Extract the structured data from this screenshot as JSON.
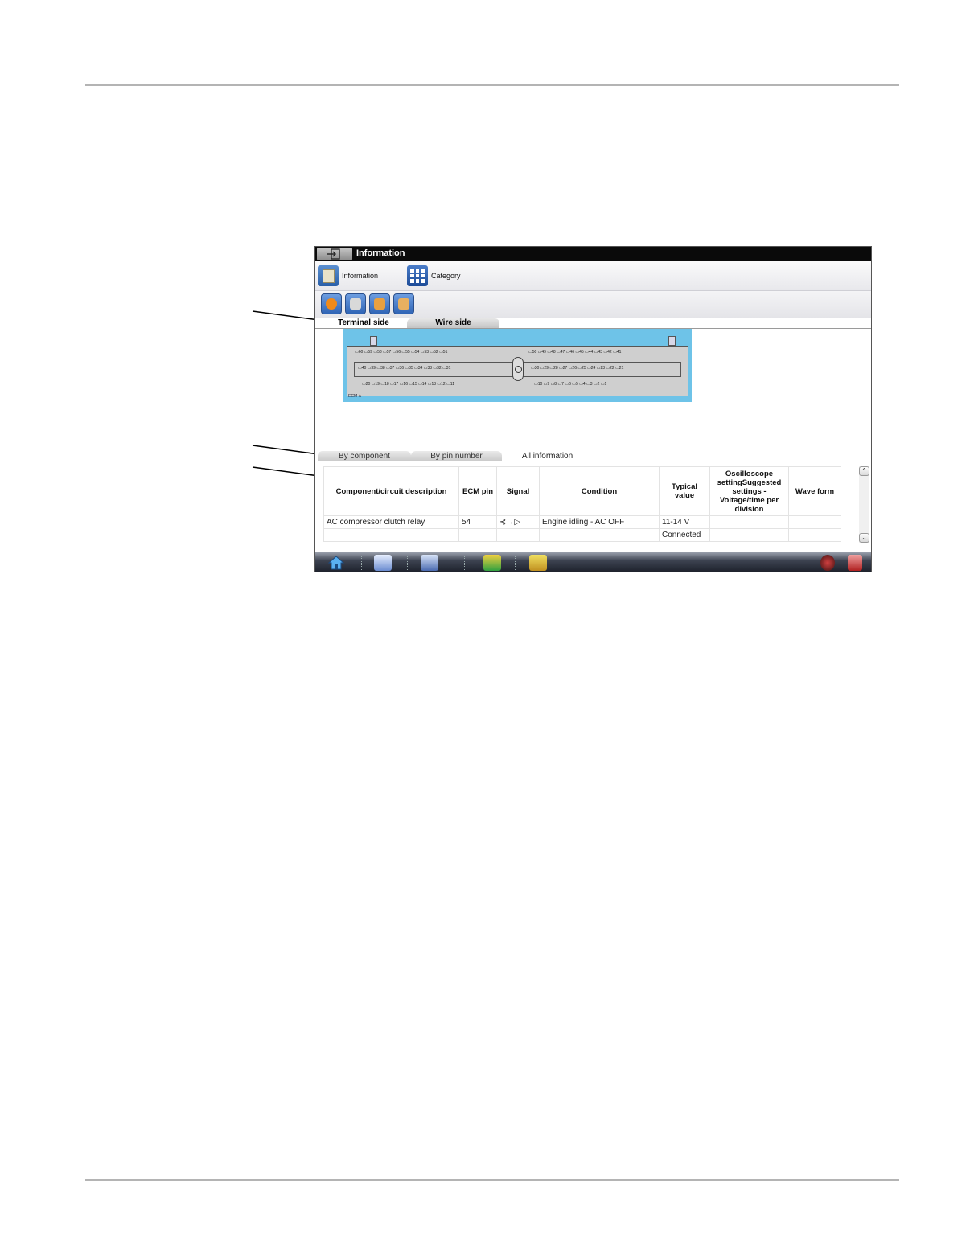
{
  "window": {
    "title": "Information"
  },
  "navbar": {
    "items": [
      {
        "label": "Information",
        "icon": "information-book-icon"
      },
      {
        "label": "Category",
        "icon": "category-grid-icon"
      }
    ]
  },
  "toolbar": {
    "buttons": [
      {
        "icon": "help-icon",
        "color": "#f08a1a"
      },
      {
        "icon": "print-icon",
        "color": "#d9d9d9"
      },
      {
        "icon": "save-icon",
        "color": "#e8a040"
      },
      {
        "icon": "open-icon",
        "color": "#e8b060"
      }
    ]
  },
  "view_tabs": {
    "items": [
      {
        "label": "Terminal side",
        "active": true
      },
      {
        "label": "Wire side",
        "active": false
      }
    ]
  },
  "connector": {
    "top_row": "▭60 ▭59 ▭58 ▭57 ▭56 ▭55 ▭54 ▭53 ▭52 ▭51",
    "top_row_right": "▭50 ▭49 ▭48 ▭47 ▭46 ▭45 ▭44 ▭43 ▭42 ▭41",
    "mid_row": "▭40 ▭39 ▭38 ▭37 ▭36 ▭35 ▭34 ▭33 ▭32 ▭31",
    "mid_row_right": "▭30 ▭29 ▭28 ▭27 ▭26 ▭25 ▭24 ▭23 ▭22 ▭21",
    "bottom_row": "▭20 ▭19 ▭18 ▭17 ▭16 ▭15 ▭14 ▭13 ▭12 ▭11",
    "bottom_row_right": "▭10 ▭9 ▭8 ▭7 ▭6 ▭5 ▭4 ▭3 ▭2 ▭1",
    "label": "ECM-A",
    "bg_color": "#6ec3e8"
  },
  "info_tabs": {
    "items": [
      {
        "label": "By component",
        "active": false
      },
      {
        "label": "By pin number",
        "active": false
      },
      {
        "label": "All information",
        "active": true
      }
    ]
  },
  "table": {
    "headers": [
      "Component/circuit description",
      "ECM pin",
      "Signal",
      "Condition",
      "Typical value",
      "Oscilloscope settingSuggested settings - Voltage/time per division",
      "Wave form"
    ],
    "rows": [
      [
        "AC compressor clutch relay",
        "54",
        "⊰→▷",
        "Engine idling - AC OFF",
        "11-14 V",
        "",
        ""
      ],
      [
        "",
        "",
        "",
        "",
        "Connected",
        "",
        ""
      ]
    ]
  },
  "scrollbar": {
    "up_arrow": "⌃",
    "down_arrow": "⌄"
  },
  "taskbar": {
    "buttons": [
      {
        "icon": "home-icon"
      },
      {
        "icon": "vehicle-data-icon"
      },
      {
        "icon": "checklist-icon"
      },
      {
        "icon": "scope-meter-icon"
      },
      {
        "icon": "toolbox-icon"
      }
    ],
    "tray_icons": [
      "fingerprint-icon",
      "battery-icon"
    ]
  }
}
